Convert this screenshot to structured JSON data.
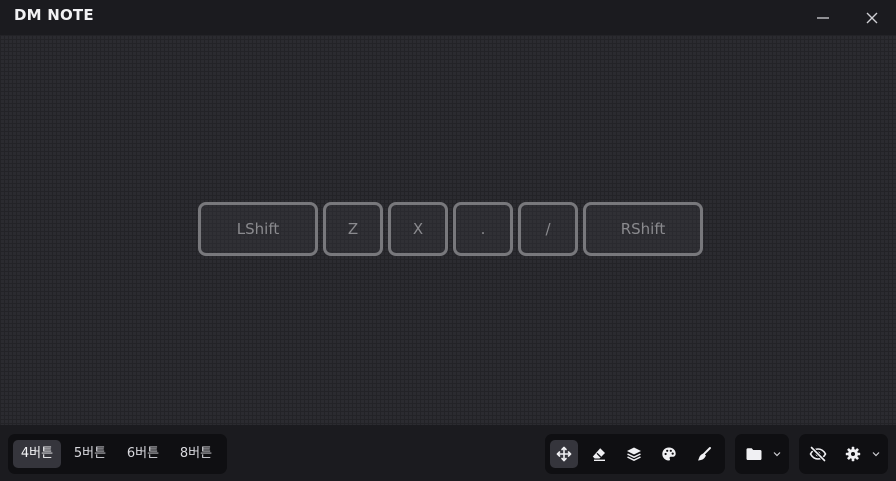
{
  "app": {
    "title": "DM NOTE"
  },
  "window_controls": {
    "minimize": "minimize-icon",
    "close": "close-icon"
  },
  "keys": [
    {
      "label": "LShift"
    },
    {
      "label": "Z"
    },
    {
      "label": "X"
    },
    {
      "label": "."
    },
    {
      "label": "/"
    },
    {
      "label": "RShift"
    }
  ],
  "modes": {
    "selected": "4버튼",
    "items": [
      "4버튼",
      "5버튼",
      "6버튼",
      "8버튼"
    ]
  },
  "tools": [
    {
      "icon": "move-icon",
      "active": true
    },
    {
      "icon": "eraser-icon",
      "active": false
    },
    {
      "icon": "layers-icon",
      "active": false
    },
    {
      "icon": "palette-icon",
      "active": false
    },
    {
      "icon": "brush-icon",
      "active": false
    }
  ],
  "file_menu": {
    "icon": "folder-icon"
  },
  "view_toggle": {
    "icon": "eye-off-icon"
  },
  "settings_menu": {
    "icon": "gear-icon"
  },
  "colors": {
    "background": "#1b1b1f",
    "canvas": "#2b2b30",
    "key_border": "#78787c",
    "key_text": "#8a8a8e",
    "toolbar_group": "#0f0f12",
    "active_button": "#35353c"
  }
}
